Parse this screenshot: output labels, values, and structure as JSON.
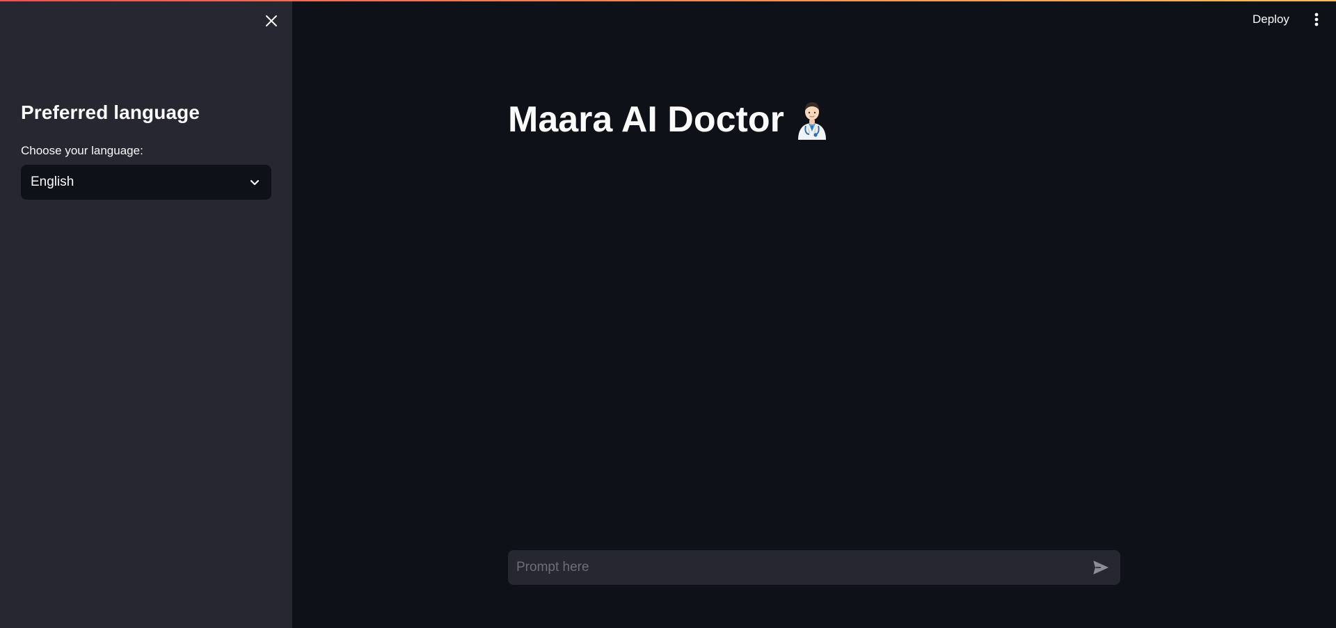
{
  "header": {
    "deploy_label": "Deploy",
    "menu_icon": "more-vertical-icon"
  },
  "sidebar": {
    "close_icon": "close-icon",
    "heading": "Preferred language",
    "language_select": {
      "label": "Choose your language:",
      "selected": "English",
      "icon": "chevron-down-icon"
    }
  },
  "main": {
    "title": "Maara AI Doctor",
    "title_icon": "doctor-emoji-icon",
    "chat_input": {
      "placeholder": "Prompt here",
      "value": "",
      "send_icon": "send-icon"
    }
  },
  "colors": {
    "background": "#0e1117",
    "sidebar": "#262730",
    "input_background": "#262730",
    "text": "#fafafa",
    "placeholder": "#6c6e78",
    "accent_gradient_start": "#ff4b4b",
    "accent_gradient_end": "#ffbd45"
  }
}
